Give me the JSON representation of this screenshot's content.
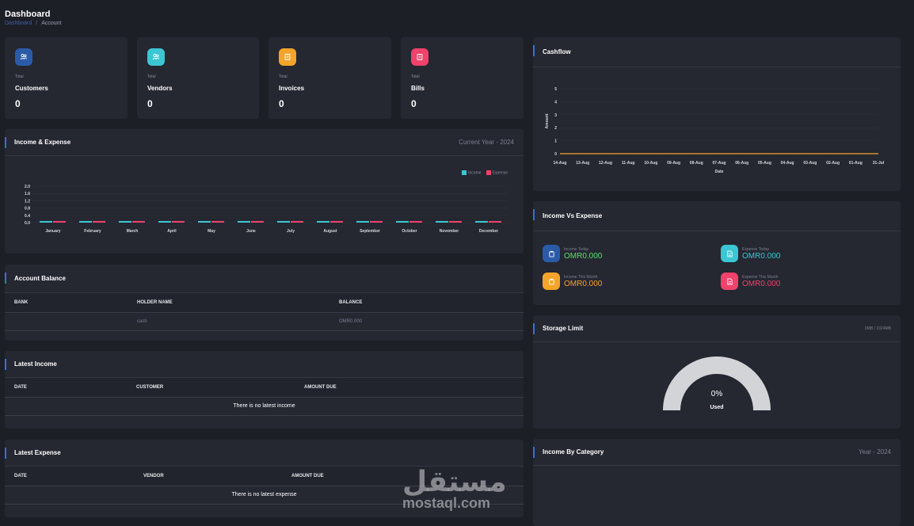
{
  "header": {
    "title": "Dashboard",
    "breadcrumb": [
      "Dashboard",
      "Account"
    ]
  },
  "stats": [
    {
      "small": "Total",
      "label": "Customers",
      "value": "0",
      "icon": "users-icon",
      "color": "#2a5ba8"
    },
    {
      "small": "Total",
      "label": "Vendors",
      "value": "0",
      "icon": "users-icon",
      "color": "#3cc6d3"
    },
    {
      "small": "Total",
      "label": "Invoices",
      "value": "0",
      "icon": "invoice-icon",
      "color": "#f4a42a"
    },
    {
      "small": "Total",
      "label": "Bills",
      "value": "0",
      "icon": "bill-icon",
      "color": "#f0426b"
    }
  ],
  "income_expense": {
    "title": "Income & Expense",
    "subtitle": "Current Year - 2024",
    "legend": [
      "Income",
      "Expense"
    ]
  },
  "account_balance": {
    "title": "Account Balance",
    "columns": [
      "BANK",
      "HOLDER NAME",
      "BALANCE"
    ],
    "rows": [
      [
        "",
        "cash",
        "OMR0.000"
      ]
    ]
  },
  "latest_income": {
    "title": "Latest Income",
    "columns": [
      "DATE",
      "CUSTOMER",
      "AMOUNT DUE"
    ],
    "empty": "There is no latest income"
  },
  "latest_expense": {
    "title": "Latest Expense",
    "columns": [
      "DATE",
      "VENDOR",
      "AMOUNT DUE"
    ],
    "empty": "There is no latest expense"
  },
  "cashflow": {
    "title": "Cashflow"
  },
  "income_vs_expense": {
    "title": "Income Vs Expense",
    "items": [
      {
        "label": "Income Today",
        "value": "OMR0.000",
        "color": "#2a5ba8",
        "text": "#5ee06b",
        "icon": "clipboard-icon"
      },
      {
        "label": "Expense Today",
        "value": "OMR0.000",
        "color": "#3cc6d3",
        "text": "#3cc6d3",
        "icon": "document-icon"
      },
      {
        "label": "Income This Month",
        "value": "OMR0.000",
        "color": "#f4a42a",
        "text": "#f4a42a",
        "icon": "clipboard-icon"
      },
      {
        "label": "Expense This Month",
        "value": "OMR0.000",
        "color": "#f0426b",
        "text": "#f0426b",
        "icon": "document-icon"
      }
    ]
  },
  "storage": {
    "title": "Storage Limit",
    "subtitle": "0MB / 1024MB",
    "percent": "0%",
    "used_label": "Used",
    "fraction": 0
  },
  "income_by_category": {
    "title": "Income By Category",
    "subtitle": "Year - 2024"
  },
  "watermark": {
    "ar": "مستقل",
    "en": "mostaql.com"
  },
  "chart_data": [
    {
      "type": "bar",
      "categories": [
        "January",
        "February",
        "March",
        "April",
        "May",
        "June",
        "July",
        "August",
        "September",
        "October",
        "November",
        "December"
      ],
      "series": [
        {
          "name": "Income",
          "values": [
            0,
            0,
            0,
            0,
            0,
            0,
            0,
            0,
            0,
            0,
            0,
            0
          ],
          "color": "#3cc6d3"
        },
        {
          "name": "Expense",
          "values": [
            0,
            0,
            0,
            0,
            0,
            0,
            0,
            0,
            0,
            0,
            0,
            0
          ],
          "color": "#f0426b"
        }
      ],
      "yticks": [
        "0.0",
        "0.4",
        "0.8",
        "1.2",
        "1.6",
        "2.0"
      ],
      "ylim": [
        0,
        2.0
      ]
    },
    {
      "type": "line",
      "x": [
        "14-Aug",
        "13-Aug",
        "12-Aug",
        "11-Aug",
        "10-Aug",
        "09-Aug",
        "08-Aug",
        "07-Aug",
        "06-Aug",
        "05-Aug",
        "04-Aug",
        "03-Aug",
        "02-Aug",
        "01-Aug",
        "31-Jul"
      ],
      "series": [
        {
          "values": [
            0,
            0,
            0,
            0,
            0,
            0,
            0,
            0,
            0,
            0,
            0,
            0,
            0,
            0,
            0
          ],
          "color": "#f4a42a"
        }
      ],
      "yticks": [
        "0",
        "1",
        "2",
        "3",
        "4",
        "5"
      ],
      "ylim": [
        0,
        5
      ],
      "xlabel": "Date",
      "ylabel": "Amount"
    }
  ]
}
